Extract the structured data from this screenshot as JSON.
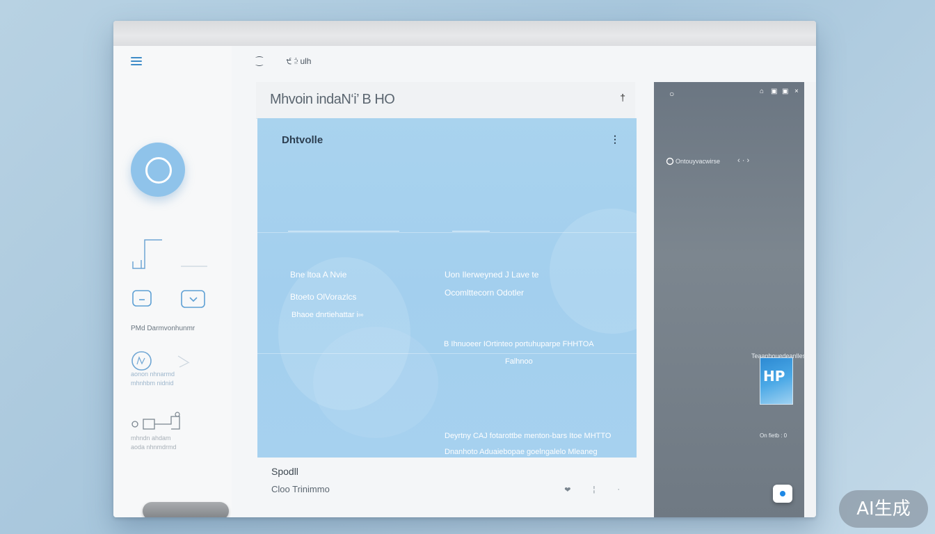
{
  "toolbar": {
    "item1": "⁐",
    "item2": "੯ ⫄ ulh"
  },
  "main_card": {
    "title": "Mhvoin indaN‘i’ B HO",
    "header_action": "†",
    "panel": {
      "title": "Dhtvolle",
      "menu": "⋮",
      "left_col": {
        "line1": "Bne ltoa A Nvie",
        "line2": "Btoeto OlVorazlcs",
        "line3": "Bhaoe dnrtiehattar i༛"
      },
      "right_col": {
        "line1": "Uon Ilerweyned J Lave te",
        "line2": "Ocomlttecorn Odotler",
        "line3": "B Ihnuoeer IOrtinteo portuhuparpe FHHTOA",
        "line4": "Falhnoo",
        "line5": "Deyrtny CAJ fotarottbe menton-bars Itoe MHTTO",
        "line6": "Dnanhoto Aduaiebopae goelngalelo Mleaneg"
      }
    },
    "footer": {
      "title": "Spodll",
      "subtitle": "Cloo   Trinimmo",
      "icons": [
        "❤",
        "¦",
        "·"
      ]
    }
  },
  "sidebar": {
    "caption1": "PMd Darmvonhunmr",
    "caption2": "aonon nhnarmd",
    "caption3": "mhnhbm nidnid",
    "caption4": "mhndn ahdam",
    "caption5": "aoda nhnmdrmd"
  },
  "right_panel": {
    "top_icons": [
      "○",
      "⌂",
      "▣",
      "▣",
      "×"
    ],
    "row_label": "Ontouyvacwirse",
    "row_arrows": "‹ · ›",
    "label2": "Teaanhouedeanlles",
    "thumb_text": "HP",
    "thumb_caption": "On fietb  : 0"
  },
  "badge": "AI生成",
  "colors": {
    "accent": "#8fc3ea",
    "panel_blue": "#a9d3ee",
    "right_panel": "#737d87",
    "fab_dot": "#1e88e5"
  }
}
